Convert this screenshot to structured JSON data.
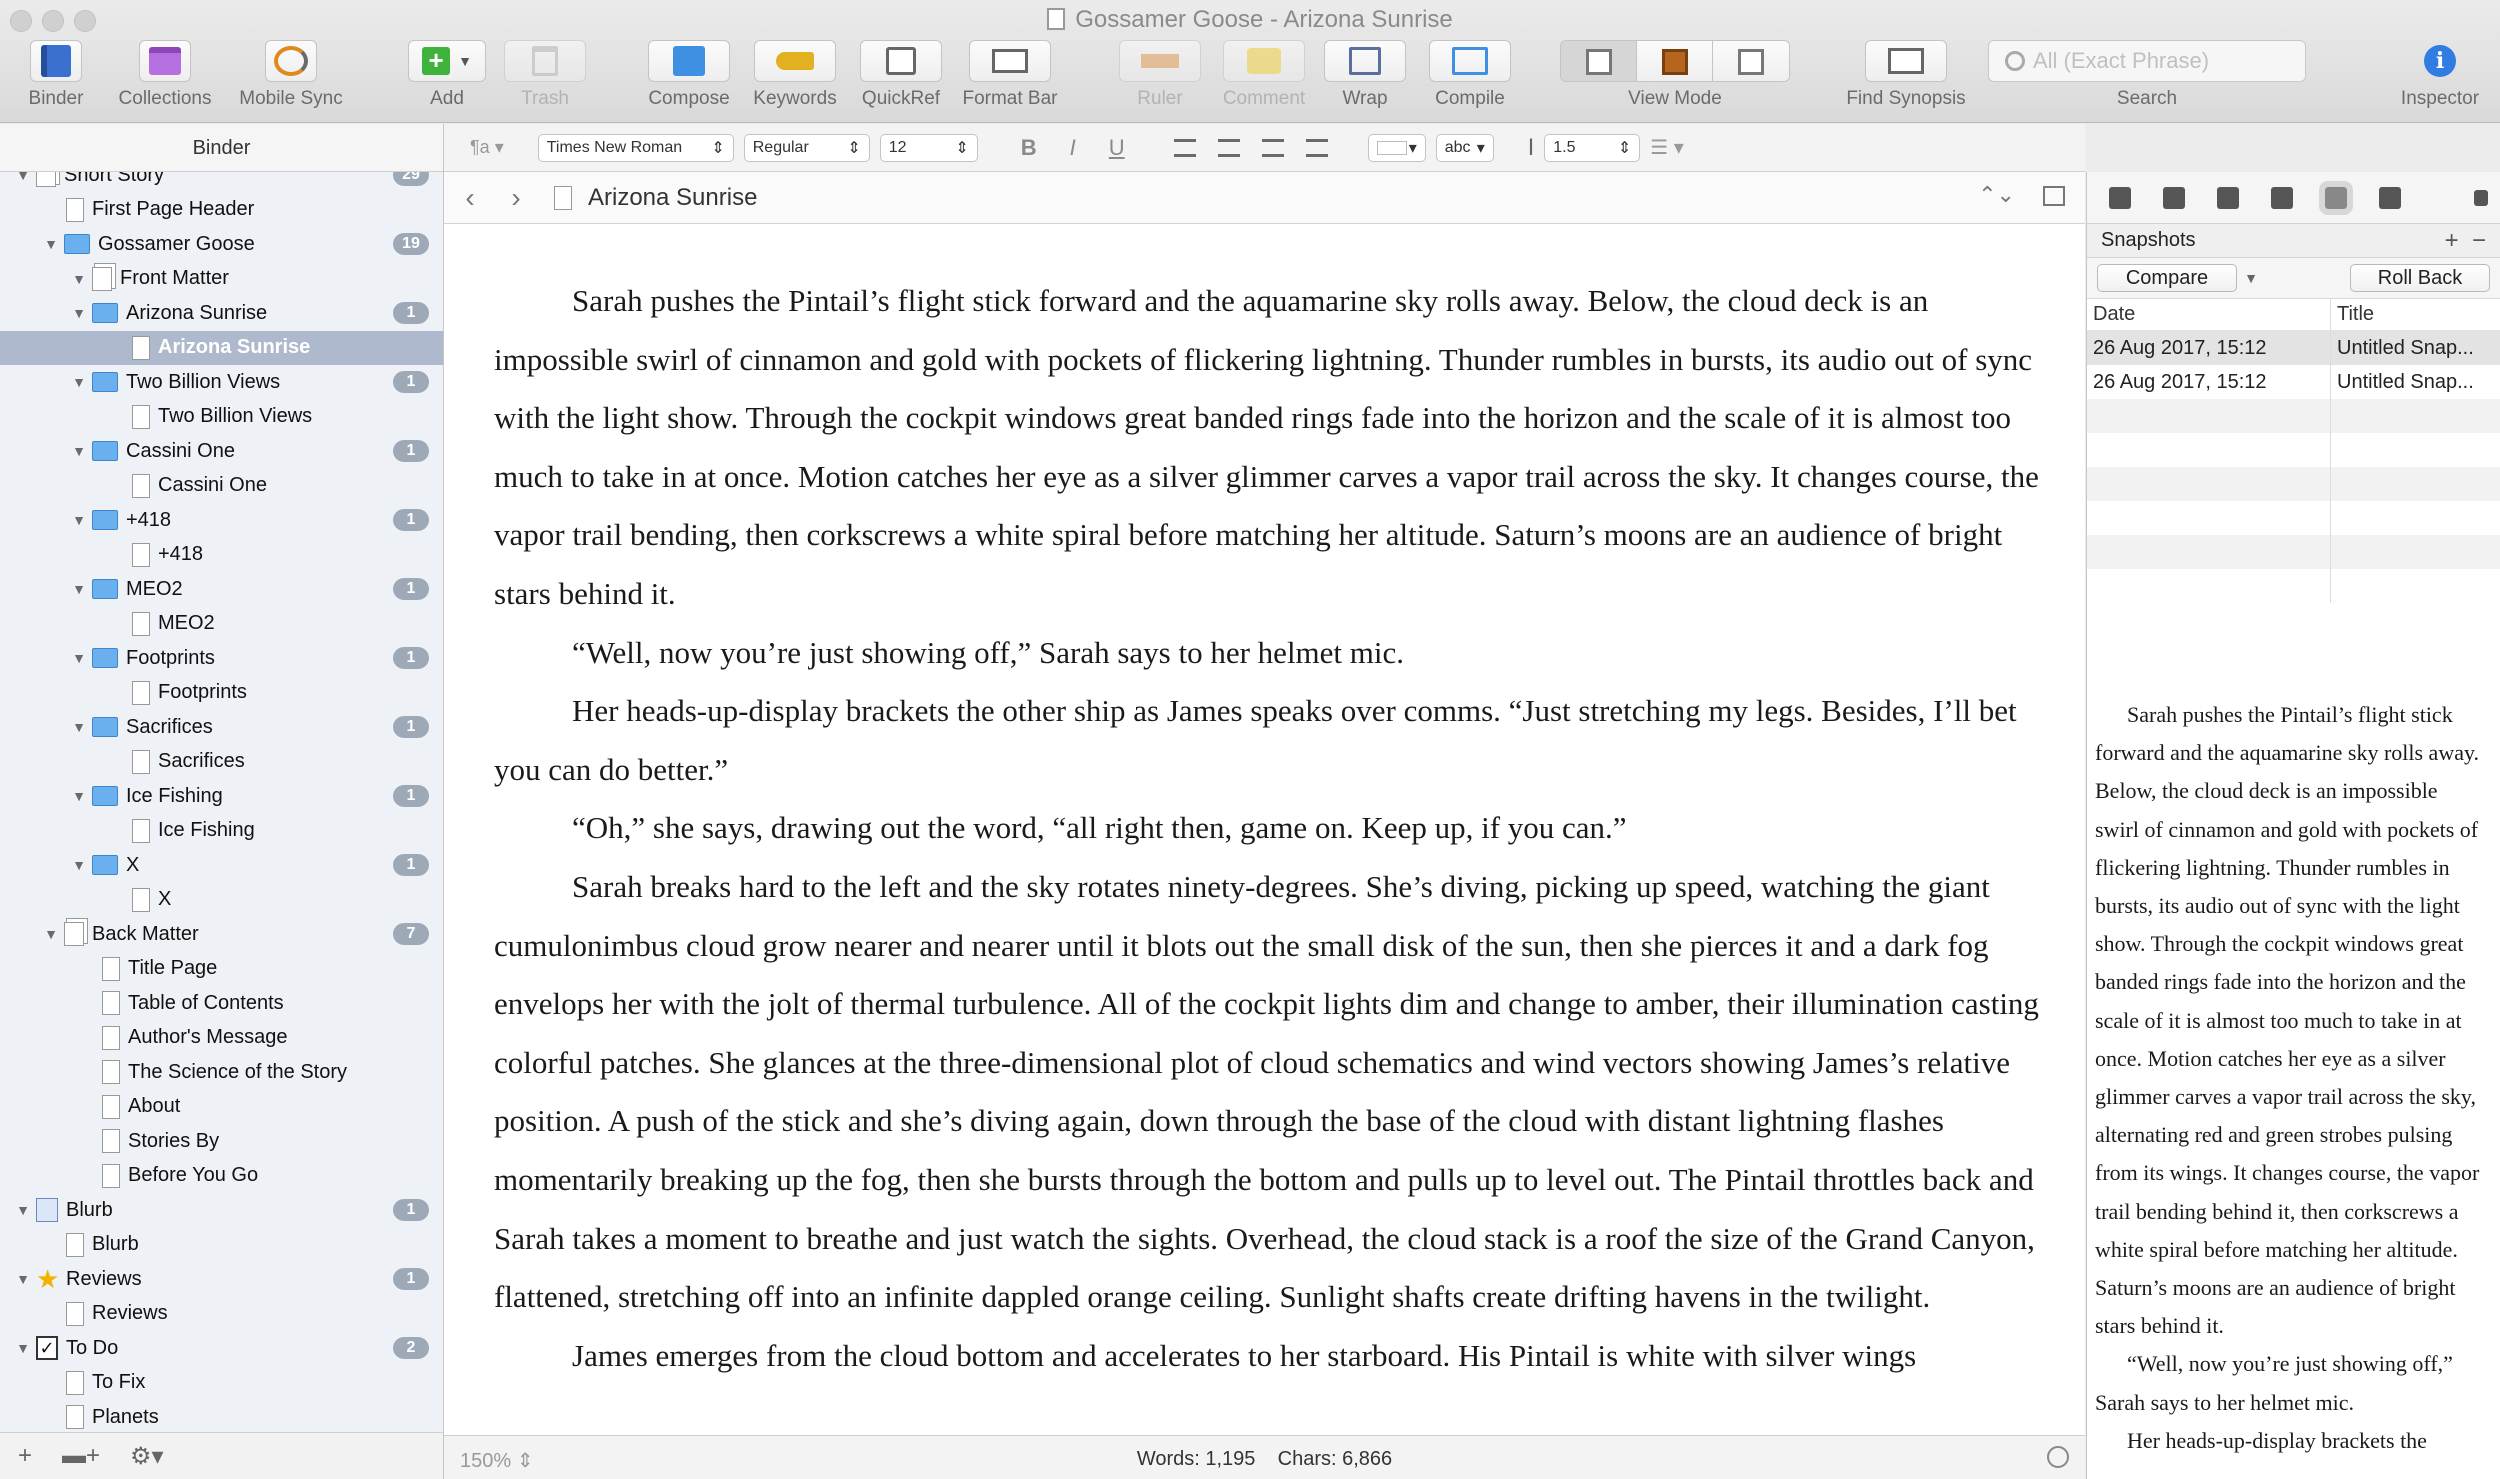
{
  "window": {
    "title": "Gossamer Goose - Arizona Sunrise"
  },
  "toolbar": {
    "binder": "Binder",
    "collections": "Collections",
    "mobile_sync": "Mobile Sync",
    "add": "Add",
    "trash": "Trash",
    "compose": "Compose",
    "keywords": "Keywords",
    "quickref": "QuickRef",
    "format_bar": "Format Bar",
    "ruler": "Ruler",
    "comment": "Comment",
    "wrap": "Wrap",
    "compile": "Compile",
    "view_mode": "View Mode",
    "find_synopsis": "Find Synopsis",
    "search_label": "Search",
    "search_placeholder": "All (Exact Phrase)",
    "inspector": "Inspector"
  },
  "binder": {
    "header": "Binder",
    "items": [
      {
        "label": "Short Story",
        "badge": "29"
      },
      {
        "label": "First Page Header"
      },
      {
        "label": "Gossamer Goose",
        "badge": "19"
      },
      {
        "label": "Front Matter"
      },
      {
        "label": "Arizona Sunrise",
        "badge": "1"
      },
      {
        "label": "Arizona Sunrise"
      },
      {
        "label": "Two Billion Views",
        "badge": "1"
      },
      {
        "label": "Two Billion Views"
      },
      {
        "label": "Cassini One",
        "badge": "1"
      },
      {
        "label": "Cassini One"
      },
      {
        "label": "+418",
        "badge": "1"
      },
      {
        "label": "+418"
      },
      {
        "label": "MEO2",
        "badge": "1"
      },
      {
        "label": "MEO2"
      },
      {
        "label": "Footprints",
        "badge": "1"
      },
      {
        "label": "Footprints"
      },
      {
        "label": "Sacrifices",
        "badge": "1"
      },
      {
        "label": "Sacrifices"
      },
      {
        "label": "Ice Fishing",
        "badge": "1"
      },
      {
        "label": "Ice Fishing"
      },
      {
        "label": "X",
        "badge": "1"
      },
      {
        "label": "X"
      },
      {
        "label": "Back Matter",
        "badge": "7"
      },
      {
        "label": "Title Page"
      },
      {
        "label": "Table of Contents"
      },
      {
        "label": "Author's Message"
      },
      {
        "label": "The Science of the Story"
      },
      {
        "label": "About"
      },
      {
        "label": "Stories By"
      },
      {
        "label": "Before You Go"
      },
      {
        "label": "Blurb",
        "badge": "1"
      },
      {
        "label": "Blurb"
      },
      {
        "label": "Reviews",
        "badge": "1"
      },
      {
        "label": "Reviews"
      },
      {
        "label": "To Do",
        "badge": "2"
      },
      {
        "label": "To Fix"
      },
      {
        "label": "Planets"
      }
    ]
  },
  "format_bar": {
    "style": "¶a",
    "font": "Times New Roman",
    "weight": "Regular",
    "size": "12",
    "bold": "B",
    "italic": "I",
    "underline": "U",
    "highlight": "abc",
    "line_spacing": "1.5"
  },
  "editor": {
    "doc_title": "Arizona Sunrise",
    "paragraphs": [
      "Sarah pushes the Pintail’s flight stick forward and the aquamarine sky rolls away. Below, the cloud deck is an impossible swirl of cinnamon and gold with pockets of flickering lightning. Thunder rumbles in bursts, its audio out of sync with the light show. Through the cockpit windows great banded rings fade into the horizon and the scale of it is almost too much to take in at once. Motion catches her eye as a silver glimmer carves a vapor trail across the sky. It changes course, the vapor trail bending, then corkscrews a white spiral before matching her altitude. Saturn’s moons are an audience of bright stars behind it.",
      "“Well, now you’re just showing off,” Sarah says to her helmet mic.",
      "Her heads-up-display brackets the other ship as James speaks over comms. “Just stretching my legs. Besides, I’ll bet you can do better.”",
      "“Oh,” she says, drawing out the word, “all right then, game on. Keep up, if you can.”",
      "Sarah breaks hard to the left and the sky rotates ninety-degrees. She’s diving, picking up speed, watching the giant cumulonimbus cloud grow nearer and nearer until it blots out the small disk of the sun, then she pierces it and a dark fog envelops her with the jolt of thermal turbulence. All of the cockpit lights dim and change to amber, their illumination casting colorful patches. She glances at the three-dimensional plot of cloud schematics and wind vectors showing James’s relative position.  A push of the stick and she’s diving again, down through the base of the cloud with distant lightning flashes momentarily breaking up the fog, then she bursts through the bottom and pulls up to level out. The Pintail throttles back and Sarah takes a moment to breathe and just watch the sights. Overhead, the cloud stack is a roof the size of the Grand Canyon, flattened, stretching off into an infinite dappled orange ceiling. Sunlight shafts create drifting havens in the twilight.",
      "James emerges from the cloud bottom and accelerates to her starboard.  His Pintail is white with silver wings"
    ],
    "zoom": "150%",
    "counts": "Words: 1,195    Chars: 6,866"
  },
  "inspector": {
    "snapshots_label": "Snapshots",
    "compare": "Compare",
    "roll_back": "Roll Back",
    "col_date": "Date",
    "col_title": "Title",
    "snapshots": [
      {
        "date": "26 Aug 2017, 15:12",
        "title": "Untitled Snap..."
      },
      {
        "date": "26 Aug 2017, 15:12",
        "title": "Untitled Snap..."
      }
    ],
    "preview_paragraphs": [
      "Sarah pushes the Pintail’s flight stick forward and the aquamarine sky rolls away. Below, the cloud deck is an impossible swirl of cinnamon and gold with pockets of flickering lightning. Thunder rumbles in bursts, its audio out of sync with the light show. Through the cockpit windows great banded rings fade into the horizon and the scale of it is almost too much to take in at once. Motion catches her eye as a silver glimmer carves a vapor trail across the sky, alternating red and green strobes pulsing from its wings. It changes course, the vapor trail bending behind it, then corkscrews a white spiral before matching her altitude. Saturn’s moons are an audience of bright stars behind it.",
      "“Well, now you’re just showing off,” Sarah says to her helmet mic.",
      "Her heads-up-display brackets the"
    ]
  }
}
